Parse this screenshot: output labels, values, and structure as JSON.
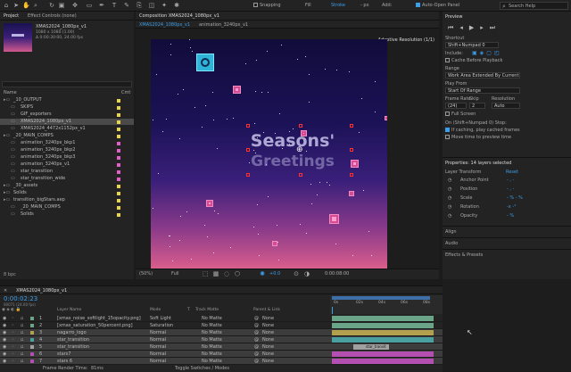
{
  "toolbar": {
    "snapping_label": "Snapping",
    "fill_label": "Fill",
    "stroke_label": "Stroke",
    "stroke_unit": "- px",
    "add_label": "Add:",
    "auto_open_label": "Auto-Open Panel",
    "search_placeholder": "Search Help"
  },
  "project": {
    "tabs": [
      "Project",
      "Effect Controls (none)"
    ],
    "thumb_name": "XMAS2024_1080px_v1",
    "thumb_info1": "1080 x 1080 (1.00)",
    "thumb_info2": "Δ 0:00:30:00, 24.00 fps",
    "search_placeholder": "",
    "col_name": "Name",
    "col_label": "Cmt",
    "items": [
      {
        "name": "_10_OUTPUT",
        "indent": 0,
        "color": "#e8d44d"
      },
      {
        "name": "SKIPS",
        "indent": 1,
        "color": "#e8d44d"
      },
      {
        "name": "GIF_exporters",
        "indent": 1,
        "color": "#e8d44d"
      },
      {
        "name": "XMAS2024_1080px_v1",
        "indent": 1,
        "color": "#e8d44d",
        "selected": true
      },
      {
        "name": "XMAS2024_4472x1152px_v1",
        "indent": 1,
        "color": "#e8d44d"
      },
      {
        "name": "_20_MAIN_COMPS",
        "indent": 0,
        "color": "#e8d44d"
      },
      {
        "name": "animation_3240px_bkp1",
        "indent": 1,
        "color": "#e35fc8"
      },
      {
        "name": "animation_3240px_bkp2",
        "indent": 1,
        "color": "#e35fc8"
      },
      {
        "name": "animation_3240px_bkp3",
        "indent": 1,
        "color": "#e35fc8"
      },
      {
        "name": "animation_3240px_v1",
        "indent": 1,
        "color": "#e35fc8"
      },
      {
        "name": "star_transition",
        "indent": 1,
        "color": "#e35fc8"
      },
      {
        "name": "star_transition_wide",
        "indent": 1,
        "color": "#e35fc8"
      },
      {
        "name": "_30_assets",
        "indent": 0,
        "color": "#e8d44d"
      },
      {
        "name": "Solids",
        "indent": 0,
        "color": "#e8d44d"
      },
      {
        "name": "transition_bigStars.aep",
        "indent": 0,
        "color": "#e8d44d"
      },
      {
        "name": "_20_MAIN_COMPS",
        "indent": 1,
        "color": "#e8d44d"
      },
      {
        "name": "Solids",
        "indent": 1,
        "color": "#e8d44d"
      }
    ],
    "footer_bpc": "8 bpc"
  },
  "comp": {
    "header_label": "Composition XMAS2024_1080px_v1",
    "tabs": [
      "XMAS2024_1080px_v1",
      "animation_3240px_v1"
    ],
    "adaptive_res": "Adaptive Resolution (1/1)",
    "title_line1": "Seasons'",
    "title_line2": "Greetings",
    "zoom": "(50%)",
    "resolution": "Full",
    "exposure": "+0.0",
    "timecode": "0:00:08:00"
  },
  "preview": {
    "title": "Preview",
    "shortcut_label": "Shortcut",
    "shortcut_value": "Shift+Numpad 0",
    "include_label": "Include:",
    "cache_label": "Cache Before Playback",
    "range_label": "Range",
    "range_value": "Work Area Extended By Current ...",
    "play_from_label": "Play From",
    "play_from_value": "Start Of Range",
    "frame_rate_label": "Frame Rate",
    "skip_label": "Skip",
    "resolution_label": "Resolution",
    "frame_rate_value": "(24)",
    "skip_value": "2",
    "resolution_value": "Auto",
    "full_screen_label": "Full Screen",
    "stop_label": "On (Shift+Numpad 0) Stop:",
    "if_caching_label": "If caching, play cached frames",
    "move_time_label": "Move time to preview time"
  },
  "properties": {
    "title": "Properties: 14 layers selected",
    "layer_transform": "Layer Transform",
    "reset": "Reset",
    "rows": [
      {
        "label": "Anchor Point",
        "value": "-  ,  -"
      },
      {
        "label": "Position",
        "value": "-  ,  -"
      },
      {
        "label": "Scale",
        "value": "- %    - %"
      },
      {
        "label": "Rotation",
        "value": "-x  -°"
      },
      {
        "label": "Opacity",
        "value": "- %"
      }
    ],
    "sections": [
      "Align",
      "Audio",
      "Effects & Presets"
    ]
  },
  "timeline": {
    "comp_tab": "XMAS2024_1080px_v1",
    "current_time": "0:00:02:23",
    "frame_info": "00071 (24.00 fps)",
    "col_layer": "Layer Name",
    "col_mode": "Mode",
    "col_t": "T",
    "col_track": "Track Matte",
    "col_parent": "Parent & Link",
    "ruler": [
      "0s",
      "02s",
      "04s",
      "06s",
      "08s"
    ],
    "layers": [
      {
        "num": "1",
        "name": "[xmas_noise_softlight_15opacity.png]",
        "mode": "Soft Light",
        "matte": "No Matte",
        "parent": "None",
        "bar": "#6aa58a",
        "selected": false
      },
      {
        "num": "2",
        "name": "[xmas_saturation_50percent.png]",
        "mode": "Saturation",
        "matte": "No Matte",
        "parent": "None",
        "bar": "#6aa58a",
        "selected": false
      },
      {
        "num": "3",
        "name": "nagarro_logo",
        "mode": "Normal",
        "matte": "No Matte",
        "parent": "None",
        "bar": "#b3a04f",
        "selected": true
      },
      {
        "num": "4",
        "name": "star_transition",
        "mode": "Normal",
        "matte": "No Matte",
        "parent": "None",
        "bar": "#4aa0a0",
        "selected": true
      },
      {
        "num": "5",
        "name": "star_transition",
        "mode": "Normal",
        "matte": "No Matte",
        "parent": "None",
        "bar": "#a0a0a0",
        "selected": true
      },
      {
        "num": "6",
        "name": "stars7",
        "mode": "Normal",
        "matte": "No Matte",
        "parent": "None",
        "bar": "#b24fb0",
        "selected": true
      },
      {
        "num": "7",
        "name": "stars 6",
        "mode": "Normal",
        "matte": "No Matte",
        "parent": "None",
        "bar": "#b24fb0",
        "selected": true
      }
    ],
    "bar_label": "star_transit",
    "footer_render": "Frame Render Time:",
    "footer_render_value": "81ms",
    "footer_toggle": "Toggle Switches / Modes"
  },
  "colors": {
    "accent": "#3d9ee8",
    "stroke_label": "#3d9ee8",
    "title_text": "#c7c2e8"
  }
}
